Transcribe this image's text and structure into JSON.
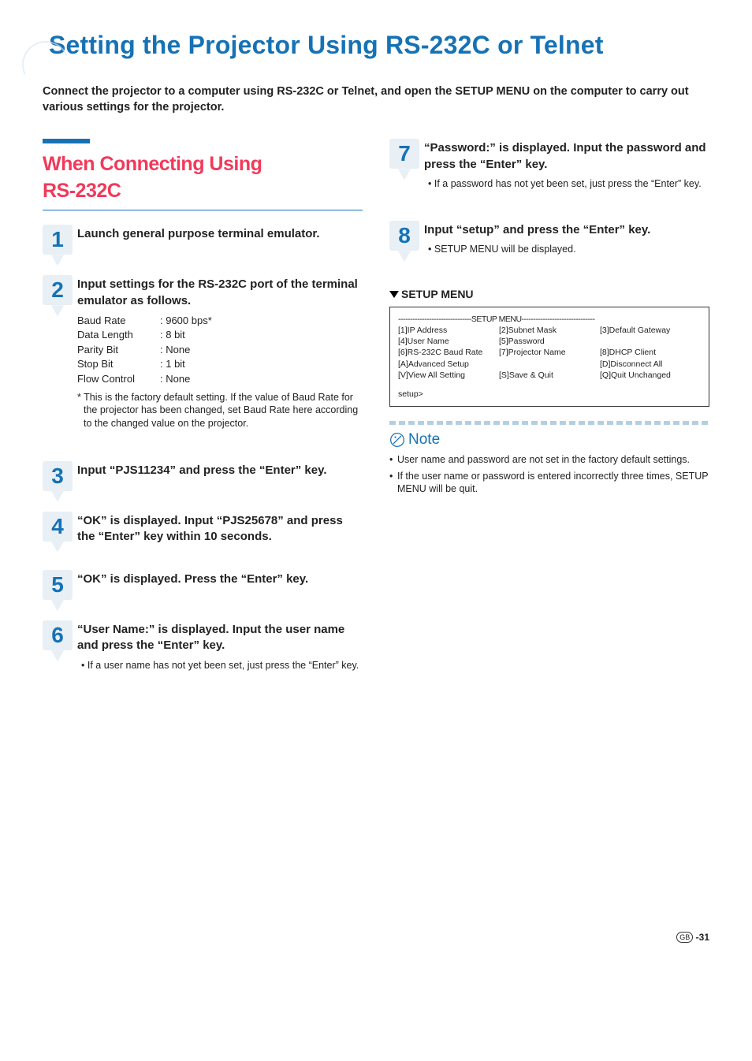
{
  "page": {
    "title": "Setting the Projector Using RS-232C or Telnet",
    "intro": "Connect the projector to a computer using RS-232C or Telnet, and open the SETUP MENU on the computer to carry out various settings for the projector.",
    "footer_gb": "GB",
    "footer_page": "-31"
  },
  "sectionA": {
    "heading_line1": "When Connecting Using",
    "heading_line2": "RS-232C"
  },
  "steps_left": [
    {
      "num": "1",
      "title": "Launch general purpose terminal emulator."
    },
    {
      "num": "2",
      "title": "Input settings for the RS-232C port of the terminal emulator as follows.",
      "settings": [
        {
          "label": "Baud Rate",
          "value": ": 9600 bps*"
        },
        {
          "label": "Data Length",
          "value": ": 8 bit"
        },
        {
          "label": "Parity Bit",
          "value": ": None"
        },
        {
          "label": "Stop Bit",
          "value": ": 1 bit"
        },
        {
          "label": "Flow Control",
          "value": ": None"
        }
      ],
      "footnote": "* This is the factory default setting. If the value of Baud Rate for the projector has been changed, set Baud Rate here according to the changed value on the projector."
    },
    {
      "num": "3",
      "title": "Input “PJS11234” and press the “Enter” key."
    },
    {
      "num": "4",
      "title": "“OK” is displayed. Input “PJS25678” and press the “Enter” key within 10 seconds."
    },
    {
      "num": "5",
      "title": "“OK” is displayed. Press the “Enter” key."
    },
    {
      "num": "6",
      "title": "“User Name:” is displayed. Input the user name and press the “Enter” key.",
      "bullet": "If a user name has not yet been set, just press the “Enter” key."
    }
  ],
  "steps_right": [
    {
      "num": "7",
      "title": "“Password:” is displayed. Input the password and press the “Enter” key.",
      "bullet": "If a password has not yet been set, just press the “Enter” key."
    },
    {
      "num": "8",
      "title": "Input “setup” and press the “Enter” key.",
      "bullet": "SETUP MENU will be displayed."
    }
  ],
  "setup_menu": {
    "heading": "SETUP MENU",
    "divider": "-------------------------------SETUP MENU-------------------------------",
    "r1c1": "[1]IP Address",
    "r1c2": "[2]Subnet Mask",
    "r1c3": "[3]Default Gateway",
    "r2c1": "[4]User Name",
    "r2c2": "[5]Password",
    "r2c3": "",
    "r3c1": "[6]RS-232C Baud Rate",
    "r3c2": "[7]Projector Name",
    "r3c3": "[8]DHCP Client",
    "r4c1": "[A]Advanced Setup",
    "r4c2": "",
    "r4c3": "[D]Disconnect All",
    "r5c1": "[V]View All Setting",
    "r5c2": "[S]Save & Quit",
    "r5c3": "[Q]Quit Unchanged",
    "prompt": "setup>"
  },
  "note": {
    "title": "Note",
    "items": [
      "User name and password are not set in the factory default settings.",
      "If the user name or password is entered incorrectly three times, SETUP MENU will be quit."
    ]
  }
}
